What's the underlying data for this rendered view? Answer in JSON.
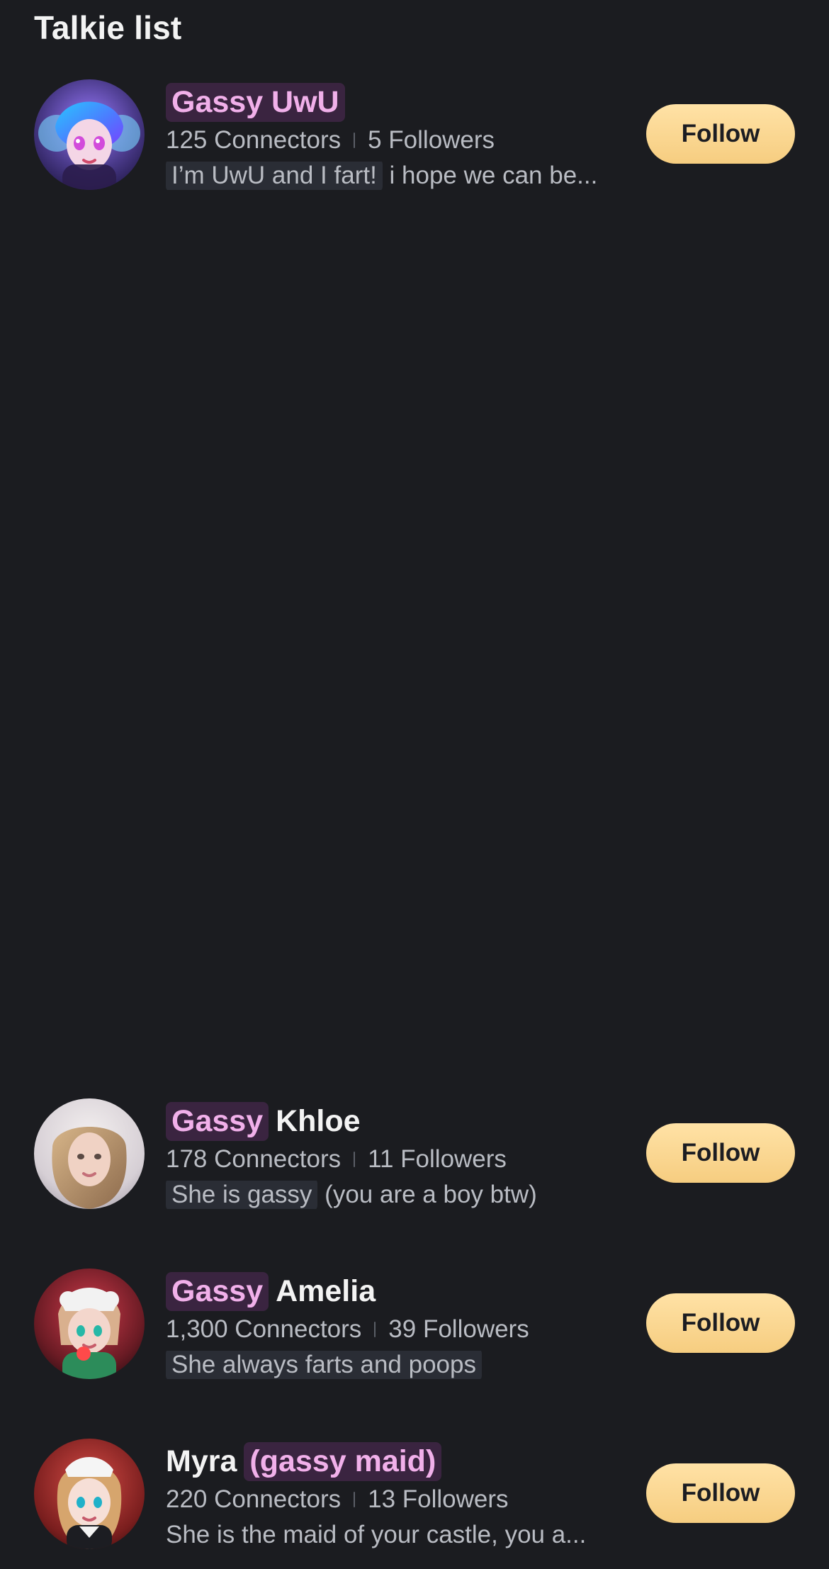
{
  "page": {
    "title": "Talkie list"
  },
  "rows": [
    {
      "name_prefix": "Gassy UwU",
      "name_suffix": "",
      "connectors": "125 Connectors",
      "followers": "5 Followers",
      "desc_highlight": "I’m UwU and I fart!",
      "desc_rest": "i hope we can be...",
      "follow_label": "Follow"
    },
    {
      "name_prefix": "Gassy",
      "name_suffix": "Khloe",
      "connectors": "178 Connectors",
      "followers": "11 Followers",
      "desc_highlight": "She is gassy",
      "desc_rest": "(you are a boy btw)",
      "follow_label": "Follow"
    },
    {
      "name_prefix": "Gassy",
      "name_suffix": "Amelia",
      "connectors": "1,300 Connectors",
      "followers": "39 Followers",
      "desc_highlight": "She always farts and poops",
      "desc_rest": "",
      "follow_label": "Follow"
    },
    {
      "name_prefix": "Myra",
      "name_suffix": "(gassy maid)",
      "connectors": "220 Connectors",
      "followers": "13 Followers",
      "desc_highlight": "",
      "desc_rest": "She is the maid of your castle, you a...",
      "follow_label": "Follow"
    }
  ],
  "icons": {
    "avatars": [
      "anime-girl-avatar-1",
      "woman-avatar-2",
      "anime-girl-avatar-3",
      "anime-maid-avatar-4"
    ]
  }
}
